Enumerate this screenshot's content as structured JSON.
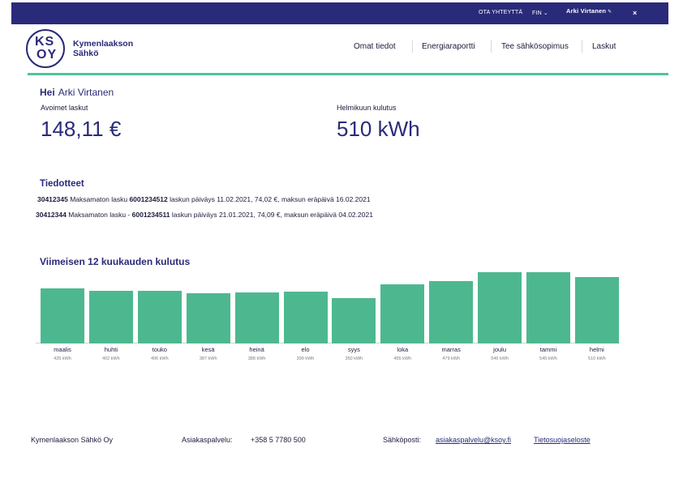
{
  "topbar": {
    "contact": "OTA YHTEYTTÄ",
    "language": "FIN",
    "user_name": "Arki Virtanen",
    "close_symbol": "×"
  },
  "brand": {
    "logo_line1": "KS",
    "logo_line2": "OY",
    "name_line1": "Kymenlaakson",
    "name_line2": "Sähkö"
  },
  "nav": {
    "items": [
      "Omat tiedot",
      "Energiaraportti",
      "Tee sähkösopimus",
      "Laskut"
    ]
  },
  "greeting": {
    "hello": "Hei",
    "name": "Arki Virtanen"
  },
  "stats": {
    "open_invoices_label": "Avoimet laskut",
    "open_invoices_value": "148,11 €",
    "consumption_label": "Helmikuun kulutus",
    "consumption_value": "510 kWh"
  },
  "news": {
    "title": "Tiedotteet",
    "rows": [
      {
        "ref": "30412345",
        "text1": "Maksamaton lasku",
        "invoice": "6001234512",
        "text2": "laskun päiväys 11.02.2021, 74,02 €, maksun eräpäivä 16.02.2021"
      },
      {
        "ref": "30412344",
        "text1": "Maksamaton lasku -",
        "invoice": "6001234511",
        "text2": "laskun päiväys 21.01.2021, 74,09 €, maksun eräpäivä 04.02.2021"
      }
    ]
  },
  "chart_data": {
    "type": "bar",
    "title": "Viimeisen 12 kuukauden kulutus",
    "categories": [
      "maalis",
      "huhti",
      "touko",
      "kesä",
      "heinä",
      "elo",
      "syys",
      "loka",
      "marras",
      "joulu",
      "tammi",
      "helmi"
    ],
    "values": [
      425,
      402,
      406,
      387,
      388,
      399,
      350,
      455,
      479,
      546,
      545,
      510
    ],
    "value_labels": [
      "425 kWh",
      "402 kWh",
      "406 kWh",
      "387 kWh",
      "388 kWh",
      "399 kWh",
      "350 kWh",
      "455 kWh",
      "479 kWh",
      "546 kWh",
      "545 kWh",
      "510 kWh"
    ],
    "ylim": [
      0,
      546
    ],
    "color": "#4db890"
  },
  "footer": {
    "company": "Kymenlaakson Sähkö Oy",
    "customer_service_label": "Asiakaspalvelu:",
    "customer_service_phone": "+358 5 7780 500",
    "email_label": "Sähköposti:",
    "email": "asiakaspalvelu@ksoy.fi",
    "privacy": "Tietosuojaseloste"
  },
  "colors": {
    "primary": "#2a2a7a",
    "accent": "#4fc3a1",
    "bar": "#4db890"
  }
}
